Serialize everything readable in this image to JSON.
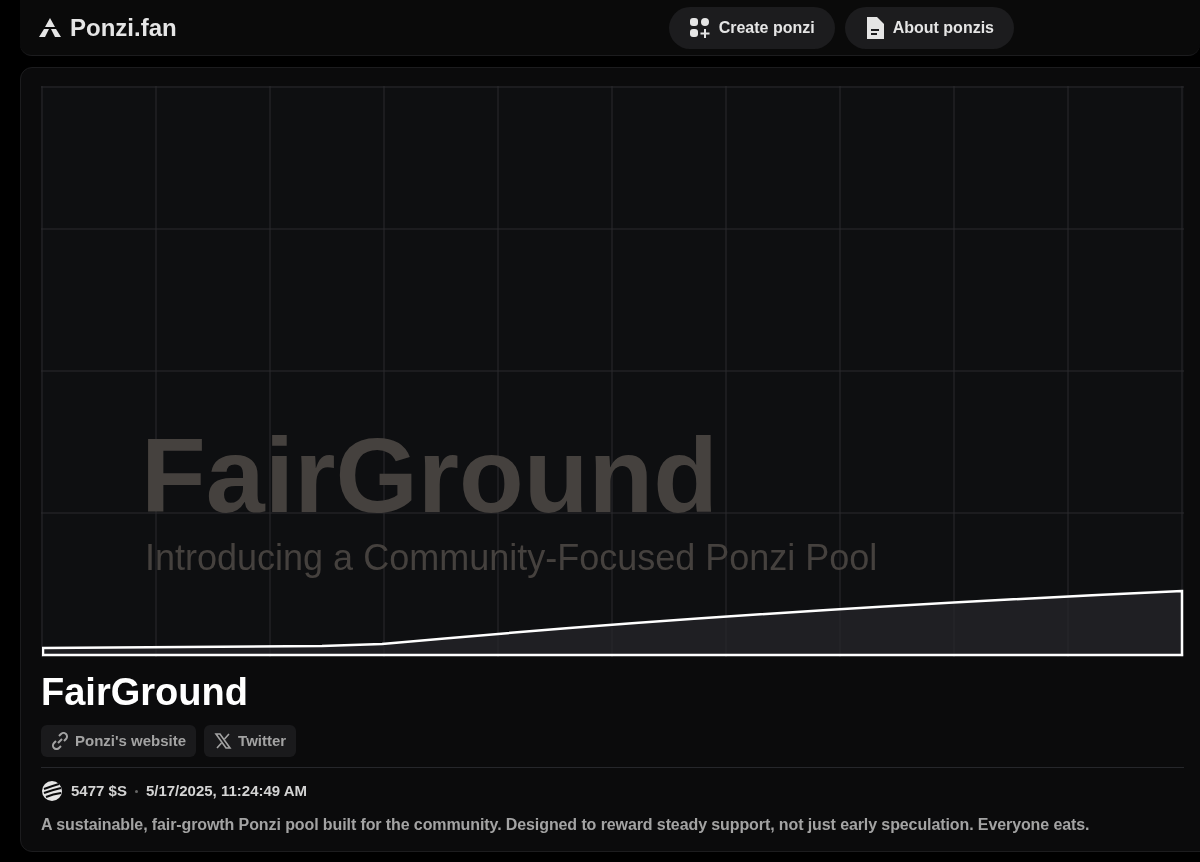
{
  "header": {
    "logo": "Ponzi.fan",
    "buttons": [
      {
        "kind": "create",
        "label": "Create ponzi"
      },
      {
        "kind": "about",
        "label": "About ponzis"
      }
    ]
  },
  "banner": {
    "title": "FairGround",
    "tagline": "Introducing a Community-Focused Ponzi Pool"
  },
  "pool": {
    "name": "FairGround",
    "links": [
      {
        "kind": "website",
        "label": "Ponzi's website"
      },
      {
        "kind": "twitter",
        "label": "Twitter"
      }
    ],
    "amount": "5477 $S",
    "timestamp": "5/17/2025, 11:24:49 AM",
    "description": "A sustainable, fair-growth Ponzi pool built for the community. Designed to reward steady support, not just early speculation. Everyone eats."
  }
}
